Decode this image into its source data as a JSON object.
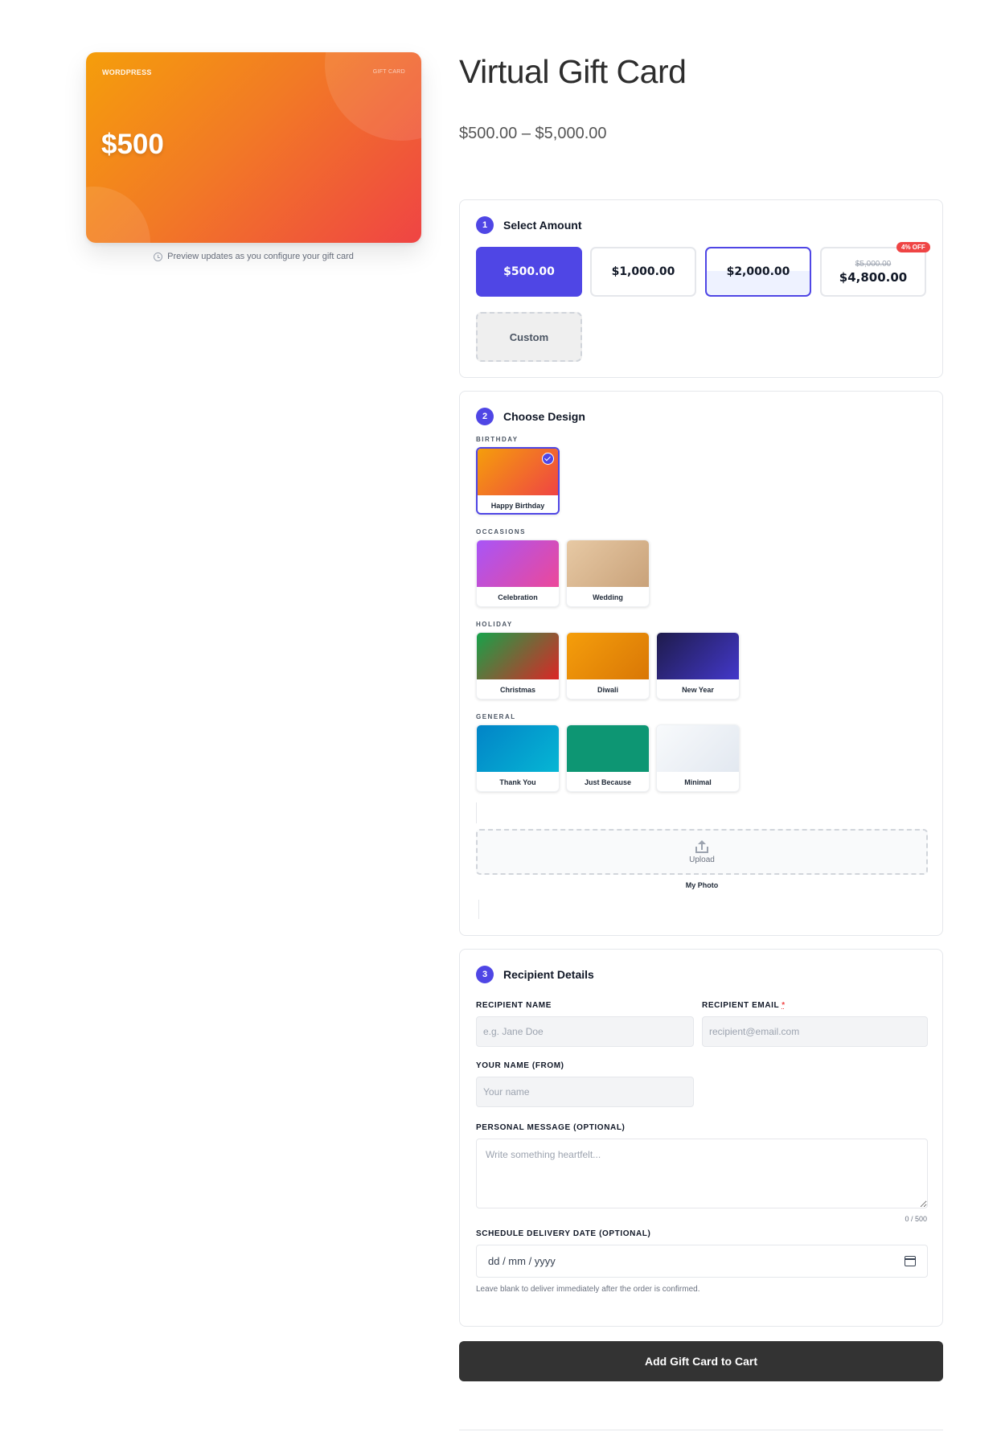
{
  "preview": {
    "brand": "WORDPRESS",
    "card_type": "GIFT CARD",
    "amount": "$500",
    "note": "Preview updates as you configure your gift card"
  },
  "product": {
    "title": "Virtual Gift Card",
    "price_range": "$500.00 – $5,000.00"
  },
  "step1": {
    "number": "1",
    "title": "Select Amount",
    "options": [
      {
        "label": "$500.00",
        "state": "selected"
      },
      {
        "label": "$1,000.00",
        "state": "default"
      },
      {
        "label": "$2,000.00",
        "state": "hovered"
      },
      {
        "label": "$4,800.00",
        "original": "$5,000.00",
        "badge": "4% OFF",
        "state": "default"
      }
    ],
    "custom_label": "Custom"
  },
  "step2": {
    "number": "2",
    "title": "Choose Design",
    "categories": [
      {
        "label": "BIRTHDAY",
        "designs": [
          {
            "label": "Happy Birthday",
            "selected": true
          }
        ]
      },
      {
        "label": "OCCASIONS",
        "designs": [
          {
            "label": "Celebration"
          },
          {
            "label": "Wedding"
          }
        ]
      },
      {
        "label": "HOLIDAY",
        "designs": [
          {
            "label": "Christmas"
          },
          {
            "label": "Diwali"
          },
          {
            "label": "New Year"
          }
        ]
      },
      {
        "label": "GENERAL",
        "designs": [
          {
            "label": "Thank You"
          },
          {
            "label": "Just Because"
          },
          {
            "label": "Minimal"
          }
        ]
      }
    ],
    "upload_text": "Upload",
    "upload_caption": "My Photo"
  },
  "step3": {
    "number": "3",
    "title": "Recipient Details",
    "recipient_name_label": "RECIPIENT NAME",
    "recipient_name_placeholder": "e.g. Jane Doe",
    "recipient_email_label": "RECIPIENT EMAIL",
    "required_mark": "*",
    "recipient_email_placeholder": "recipient@email.com",
    "from_label": "YOUR NAME (FROM)",
    "from_placeholder": "Your name",
    "message_label": "PERSONAL MESSAGE (OPTIONAL)",
    "message_placeholder": "Write something heartfelt...",
    "message_counter": "0 / 500",
    "date_label": "SCHEDULE DELIVERY DATE (OPTIONAL)",
    "date_placeholder": "dd / mm / yyyy",
    "date_help": "Leave blank to deliver immediately after the order is confirmed."
  },
  "cart": {
    "button_label": "Add Gift Card to Cart"
  },
  "colors": {
    "accent": "#4f46e5",
    "badge": "#ef4444",
    "button": "#333333"
  },
  "icons": {
    "preview_note": "clock-icon",
    "upload": "upload-icon",
    "date": "calendar-icon",
    "selected_design": "check-icon"
  }
}
